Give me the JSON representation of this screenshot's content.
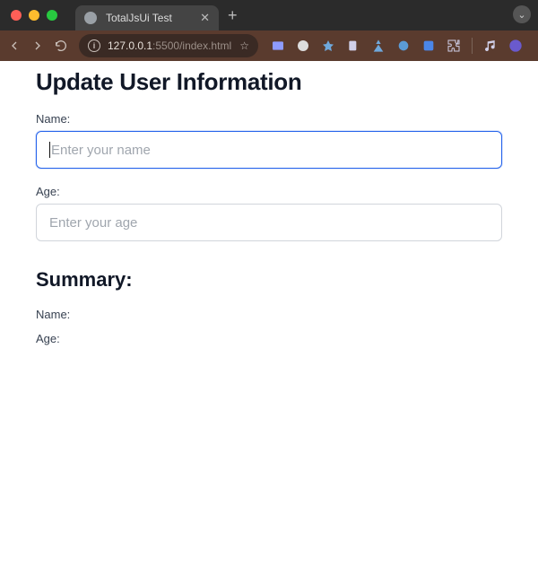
{
  "window": {
    "tab_title": "TotalJsUi Test"
  },
  "toolbar": {
    "url_host": "127.0.0.1",
    "url_port": ":5500",
    "url_path": "/index.html"
  },
  "page": {
    "heading": "Update User Information",
    "fields": {
      "name": {
        "label": "Name:",
        "placeholder": "Enter your name",
        "value": ""
      },
      "age": {
        "label": "Age:",
        "placeholder": "Enter your age",
        "value": ""
      }
    },
    "summary": {
      "heading": "Summary:",
      "name_label": "Name:",
      "name_value": "",
      "age_label": "Age:",
      "age_value": ""
    }
  }
}
